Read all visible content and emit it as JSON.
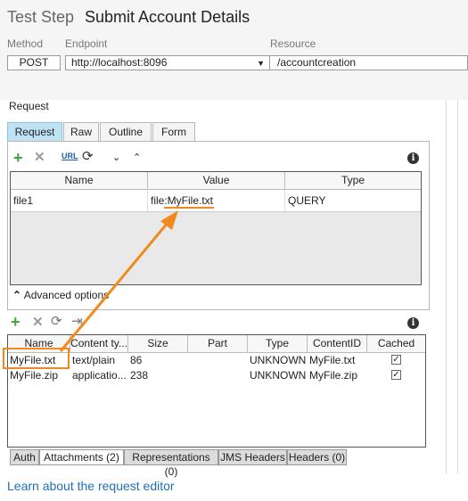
{
  "header": {
    "title_prefix": "Test Step",
    "title": "Submit Account Details"
  },
  "fields": {
    "method_label": "Method",
    "endpoint_label": "Endpoint",
    "resource_label": "Resource",
    "method": "POST",
    "endpoint": "http://localhost:8096",
    "resource": "/accountcreation"
  },
  "request": {
    "label": "Request",
    "tabs": [
      "Request",
      "Raw",
      "Outline",
      "Form"
    ],
    "params": {
      "columns": [
        "Name",
        "Value",
        "Type"
      ],
      "rows": [
        {
          "name": "file1",
          "value": "file:MyFile.txt",
          "type": "QUERY"
        }
      ]
    },
    "advanced_options": "Advanced options"
  },
  "attachments": {
    "columns": [
      "Name",
      "Content ty...",
      "Size",
      "Part",
      "Type",
      "ContentID",
      "Cached"
    ],
    "rows": [
      {
        "name": "MyFile.txt",
        "content_type": "text/plain",
        "size": "86",
        "part": "",
        "type": "UNKNOWN",
        "content_id": "MyFile.txt",
        "cached": true
      },
      {
        "name": "MyFile.zip",
        "content_type": "applicatio...",
        "size": "238",
        "part": "",
        "type": "UNKNOWN",
        "content_id": "MyFile.zip",
        "cached": true
      }
    ]
  },
  "bottom_tabs": [
    "Auth",
    "Attachments (2)",
    "Representations (0)",
    "JMS Headers",
    "Headers (0)"
  ],
  "learn_link": "Learn about the request editor",
  "colors": {
    "accent": "#f08a1e",
    "tab_active": "#bfe2f5",
    "link": "#1f6fb5"
  }
}
